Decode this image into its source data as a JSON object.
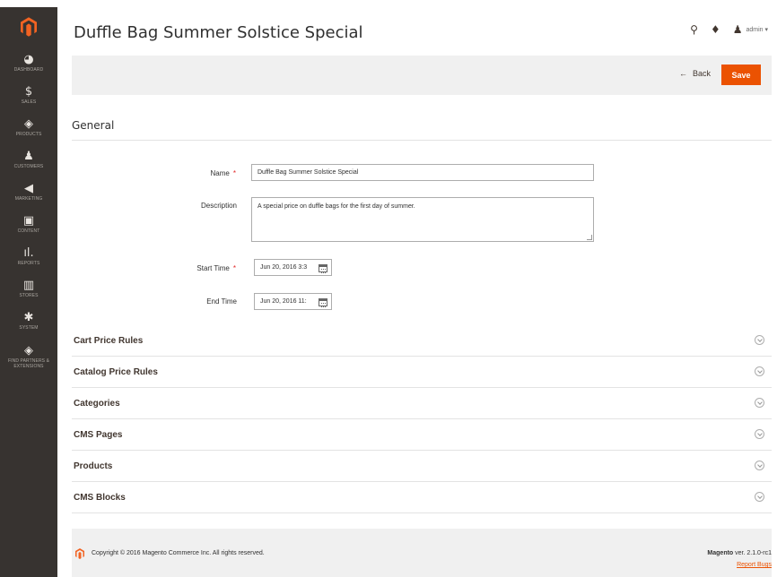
{
  "sidebar": {
    "logo_icon": "magento-logo-icon",
    "items": [
      {
        "label": "DASHBOARD",
        "icon": "dashboard-icon",
        "glyph": "◕"
      },
      {
        "label": "SALES",
        "icon": "dollar-icon",
        "glyph": "$"
      },
      {
        "label": "PRODUCTS",
        "icon": "cube-icon",
        "glyph": "◈"
      },
      {
        "label": "CUSTOMERS",
        "icon": "person-icon",
        "glyph": "♟"
      },
      {
        "label": "MARKETING",
        "icon": "megaphone-icon",
        "glyph": "◀"
      },
      {
        "label": "CONTENT",
        "icon": "content-icon",
        "glyph": "▣"
      },
      {
        "label": "REPORTS",
        "icon": "bar-chart-icon",
        "glyph": "ıl."
      },
      {
        "label": "STORES",
        "icon": "store-icon",
        "glyph": "▥"
      },
      {
        "label": "SYSTEM",
        "icon": "gear-icon",
        "glyph": "✱"
      },
      {
        "label": "FIND PARTNERS & EXTENSIONS",
        "icon": "cube-icon",
        "glyph": "◈"
      }
    ]
  },
  "header": {
    "title": "Duffle Bag Summer Solstice Special",
    "search_glyph": "⚲",
    "bell_glyph": "♦",
    "admin_glyph": "♟",
    "admin_label": "admin ▾"
  },
  "actions": {
    "back_arrow": "←",
    "back_label": "Back",
    "save_label": "Save"
  },
  "general": {
    "title": "General",
    "name_label": "Name",
    "name_value": "Duffle Bag Summer Solstice Special",
    "description_label": "Description",
    "description_value": "A special price on duffle bags for the first day of summer.",
    "start_label": "Start Time",
    "start_value": "Jun 20, 2016 3:3",
    "end_label": "End Time",
    "end_value": "Jun 20, 2016 11:",
    "required_mark": "*"
  },
  "sections": [
    {
      "title": "Cart Price Rules"
    },
    {
      "title": "Catalog Price Rules"
    },
    {
      "title": "Categories"
    },
    {
      "title": "CMS Pages"
    },
    {
      "title": "Products"
    },
    {
      "title": "CMS Blocks"
    }
  ],
  "footer": {
    "copyright": "Copyright © 2016 Magento Commerce Inc. All rights reserved.",
    "brand": "Magento",
    "version": " ver. 2.1.0-rc1",
    "report_bugs": "Report Bugs"
  },
  "colors": {
    "accent": "#eb5202",
    "sidebar_bg": "#373330",
    "required": "#e22626"
  }
}
